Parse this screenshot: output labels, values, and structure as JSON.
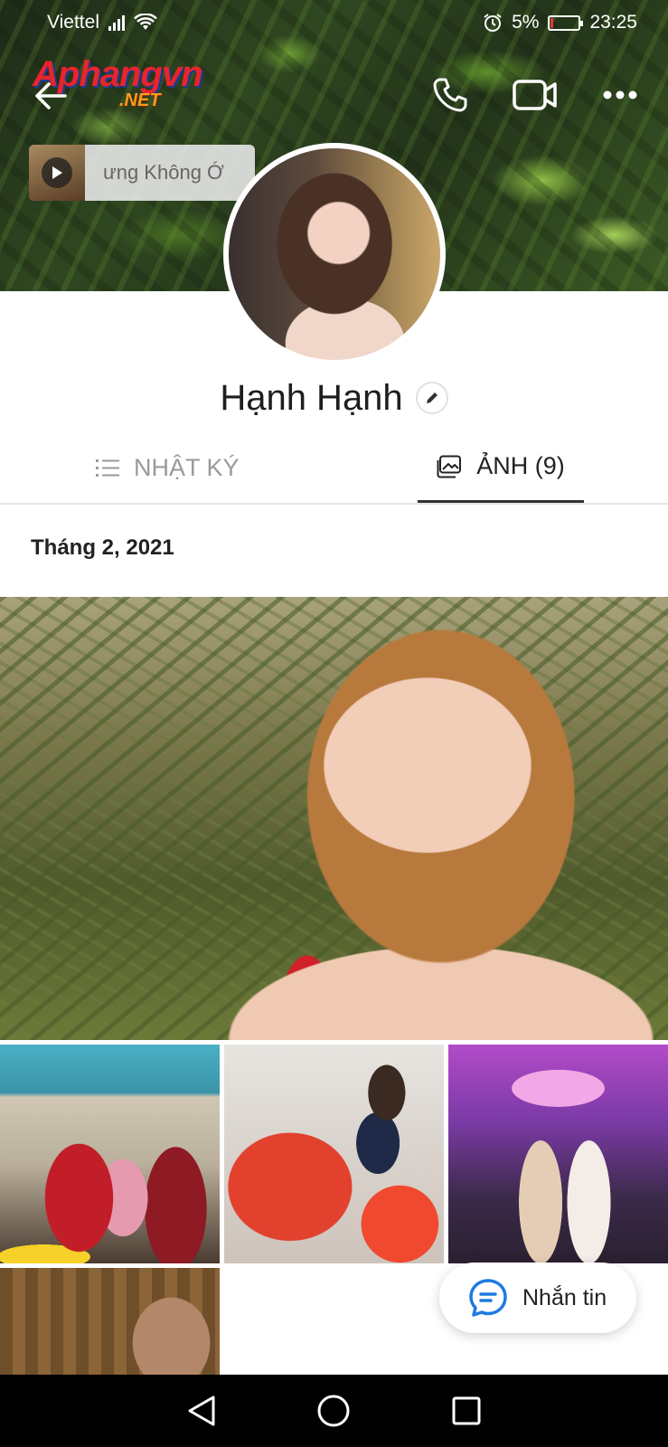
{
  "status_bar": {
    "carrier": "Viettel",
    "battery_percent": "5%",
    "time": "23:25"
  },
  "watermark": {
    "main": "Aphangvn",
    "sub": ".NET"
  },
  "music": {
    "title": "ưng Không Ớ"
  },
  "profile": {
    "name": "Hạnh Hạnh"
  },
  "tabs": [
    {
      "label": "NHẬT KÝ",
      "active": false,
      "icon": "list-icon"
    },
    {
      "label": "ẢNH (9)",
      "active": true,
      "icon": "photo-icon"
    }
  ],
  "section": {
    "date": "Tháng 2, 2021"
  },
  "fab": {
    "label": "Nhắn tin",
    "icon": "chat-bubble-icon"
  },
  "colors": {
    "accent": "#1f7ae0",
    "text": "#222222",
    "muted": "#9a9a9a"
  }
}
